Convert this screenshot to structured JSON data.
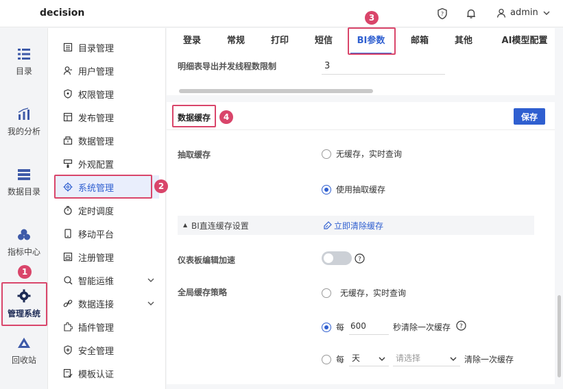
{
  "app": {
    "title": "decision",
    "user": "admin"
  },
  "rail": [
    {
      "label": "目录",
      "icon": "catalog-icon"
    },
    {
      "label": "我的分析",
      "icon": "analysis-icon"
    },
    {
      "label": "数据目录",
      "icon": "data-catalog-icon"
    },
    {
      "label": "指标中心",
      "icon": "metrics-icon"
    },
    {
      "label": "管理系统",
      "icon": "gear-icon",
      "active": true
    },
    {
      "label": "回收站",
      "icon": "recycle-icon"
    }
  ],
  "menu": [
    {
      "label": "目录管理",
      "icon": "directory-icon"
    },
    {
      "label": "用户管理",
      "icon": "user-icon"
    },
    {
      "label": "权限管理",
      "icon": "shield-icon"
    },
    {
      "label": "发布管理",
      "icon": "publish-icon"
    },
    {
      "label": "数据管理",
      "icon": "database-icon"
    },
    {
      "label": "外观配置",
      "icon": "brush-icon"
    },
    {
      "label": "系统管理",
      "icon": "settings-icon",
      "active": true
    },
    {
      "label": "定时调度",
      "icon": "timer-icon"
    },
    {
      "label": "移动平台",
      "icon": "mobile-icon"
    },
    {
      "label": "注册管理",
      "icon": "register-icon"
    },
    {
      "label": "智能运维",
      "icon": "ops-icon",
      "expandable": true
    },
    {
      "label": "数据连接",
      "icon": "link-icon",
      "expandable": true
    },
    {
      "label": "插件管理",
      "icon": "plugin-icon"
    },
    {
      "label": "安全管理",
      "icon": "security-icon"
    },
    {
      "label": "模板认证",
      "icon": "template-icon"
    }
  ],
  "tabs": [
    "登录",
    "常规",
    "打印",
    "短信",
    "BI参数",
    "邮箱",
    "其他",
    "AI模型配置"
  ],
  "active_tab": "BI参数",
  "detail_export": {
    "label": "明细表导出并发线程数限制",
    "value": "3"
  },
  "cache": {
    "section_title": "数据缓存",
    "save_label": "保存",
    "extract_label": "抽取缓存",
    "extract_options": [
      "无缓存，实时查询",
      "使用抽取缓存"
    ],
    "extract_selected": "使用抽取缓存",
    "bi_direct_label": "BI直连缓存设置",
    "clear_now_label": "立即清除缓存",
    "dashboard_edit_label": "仪表板编辑加速",
    "dashboard_edit_enabled": false,
    "global_label": "全局缓存策略",
    "global_option_none": "无缓存，实时查询",
    "every_label": "每",
    "every_seconds_value": "600",
    "seconds_suffix": "秒清除一次缓存",
    "day_unit": "天",
    "select_placeholder": "请选择",
    "clear_once_suffix": "清除一次缓存"
  },
  "annotations": [
    "1",
    "2",
    "3",
    "4"
  ]
}
